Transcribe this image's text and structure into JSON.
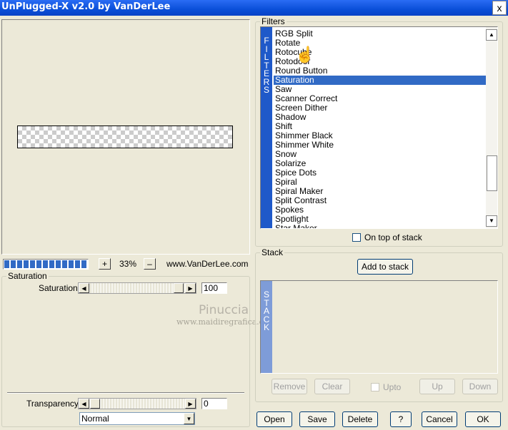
{
  "window": {
    "title": "UnPlugged-X v2.0 by VanDerLee",
    "close_label": "x"
  },
  "preview": {
    "zoom_label": "33%",
    "zoom_in": "+",
    "zoom_out": "–",
    "website": "www.VanDerLee.com",
    "progress_fraction": 1.0
  },
  "settings": {
    "group_label": "Saturation",
    "saturation": {
      "label": "Saturation",
      "value": "100"
    },
    "transparency": {
      "label": "Transparency",
      "value": "0"
    },
    "blend_mode": "Normal"
  },
  "watermark": {
    "name": "Pinuccia",
    "site": "www.maidiregrafica.eu"
  },
  "filters": {
    "group_label": "Filters",
    "side_label": [
      "F",
      "I",
      "L",
      "T",
      "E",
      "R",
      "S"
    ],
    "items": [
      "RGB Split",
      "Rotate",
      "Rotocube",
      "Rotodoor",
      "Round Button",
      "Saturation",
      "Saw",
      "Scanner Correct",
      "Screen Dither",
      "Shadow",
      "Shift",
      "Shimmer Black",
      "Shimmer White",
      "Snow",
      "Solarize",
      "Spice Dots",
      "Spiral",
      "Spiral Maker",
      "Split Contrast",
      "Spokes",
      "Spotlight",
      "Star Maker"
    ],
    "selected": "Saturation",
    "on_top_label": "On top of stack"
  },
  "stack": {
    "group_label": "Stack",
    "add_label": "Add to stack",
    "side_label": [
      "S",
      "T",
      "A",
      "C",
      "K"
    ],
    "remove_label": "Remove",
    "clear_label": "Clear",
    "upto_label": "Upto",
    "up_label": "Up",
    "down_label": "Down"
  },
  "footer": {
    "open": "Open",
    "save": "Save",
    "delete": "Delete",
    "help": "?",
    "cancel": "Cancel",
    "ok": "OK"
  },
  "icons": {
    "scroll_up": "▲",
    "scroll_down": "▼",
    "arrow_left": "◀",
    "arrow_right": "▶",
    "dropdown": "▼",
    "hand_cursor": "☝"
  }
}
